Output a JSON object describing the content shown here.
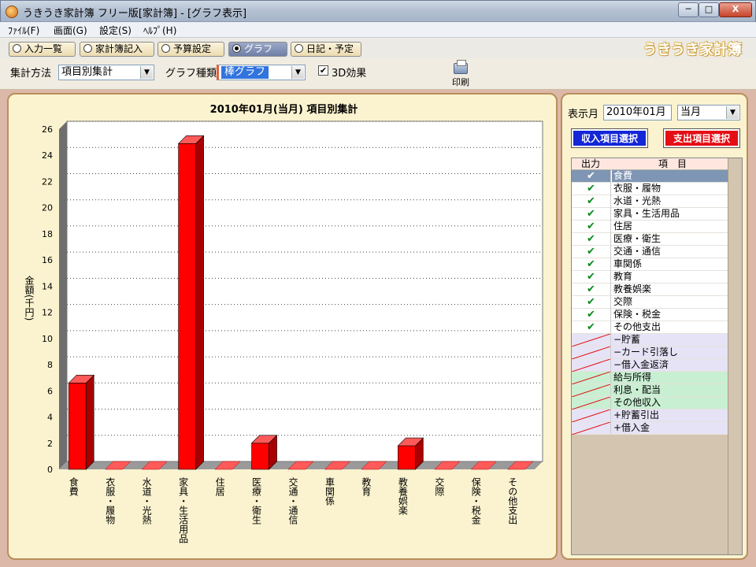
{
  "window": {
    "title": "うきうき家計簿 フリー版[家計簿] - [グラフ表示]",
    "minimize_label": "─",
    "maximize_label": "□",
    "close_label": "X"
  },
  "menu": [
    "ﾌｧｲﾙ(F)",
    "画面(G)",
    "設定(S)",
    "ﾍﾙﾌﾟ(H)"
  ],
  "tabs": [
    {
      "label": "入力一覧",
      "active": false
    },
    {
      "label": "家計簿記入",
      "active": false
    },
    {
      "label": "予算設定",
      "active": false
    },
    {
      "label": "グラフ",
      "active": true
    },
    {
      "label": "日記・予定",
      "active": false
    }
  ],
  "brand": "うきうき家計簿",
  "toolbar": {
    "aggregation_label": "集計方法",
    "aggregation_value": "項目別集計",
    "graph_type_label": "グラフ種類",
    "graph_type_value": "棒グラフ",
    "effect_3d_label": "3D効果",
    "effect_3d_checked": true,
    "print_label": "印刷"
  },
  "side": {
    "month_label": "表示月",
    "month_value": "2010年01月",
    "period_value": "当月",
    "income_button": "収入項目選択",
    "expense_button": "支出項目選択",
    "col_output": "出力",
    "col_item": "項　目",
    "items": [
      {
        "name": "食費",
        "checked": true,
        "kind": "exp",
        "selected": true
      },
      {
        "name": "衣服・履物",
        "checked": true,
        "kind": "exp"
      },
      {
        "name": "水道・光熱",
        "checked": true,
        "kind": "exp"
      },
      {
        "name": "家具・生活用品",
        "checked": true,
        "kind": "exp"
      },
      {
        "name": "住居",
        "checked": true,
        "kind": "exp"
      },
      {
        "name": "医療・衛生",
        "checked": true,
        "kind": "exp"
      },
      {
        "name": "交通・通信",
        "checked": true,
        "kind": "exp"
      },
      {
        "name": "車関係",
        "checked": true,
        "kind": "exp"
      },
      {
        "name": "教育",
        "checked": true,
        "kind": "exp"
      },
      {
        "name": "教養娯楽",
        "checked": true,
        "kind": "exp"
      },
      {
        "name": "交際",
        "checked": true,
        "kind": "exp"
      },
      {
        "name": "保険・税金",
        "checked": true,
        "kind": "exp"
      },
      {
        "name": "その他支出",
        "checked": true,
        "kind": "exp"
      },
      {
        "name": "−貯蓄",
        "checked": false,
        "kind": "ded"
      },
      {
        "name": "−カード引落し",
        "checked": false,
        "kind": "ded"
      },
      {
        "name": "−借入金返済",
        "checked": false,
        "kind": "ded"
      },
      {
        "name": "給与所得",
        "checked": false,
        "kind": "inc"
      },
      {
        "name": "利息・配当",
        "checked": false,
        "kind": "inc"
      },
      {
        "name": "その他収入",
        "checked": false,
        "kind": "inc"
      },
      {
        "name": "+貯蓄引出",
        "checked": false,
        "kind": "ded2"
      },
      {
        "name": "+借入金",
        "checked": false,
        "kind": "ded2"
      }
    ]
  },
  "chart_data": {
    "type": "bar",
    "title": "2010年01月(当月) 項目別集計",
    "ylabel": "金額(千円)",
    "ylim": [
      0,
      26
    ],
    "yticks": [
      0,
      2,
      4,
      6,
      8,
      10,
      12,
      14,
      16,
      18,
      20,
      22,
      24,
      26
    ],
    "grid": true,
    "effect_3d": true,
    "categories": [
      "食費",
      "衣服・履物",
      "水道・光熱",
      "家具・生活用品",
      "住居",
      "医療・衛生",
      "交通・通信",
      "車関係",
      "教育",
      "教養娯楽",
      "交際",
      "保険・税金",
      "その他支出"
    ],
    "values": [
      6.6,
      0,
      0,
      24.9,
      0,
      2.0,
      0,
      0,
      0,
      1.8,
      0,
      0,
      0
    ],
    "bar_color": "#ff0000"
  }
}
